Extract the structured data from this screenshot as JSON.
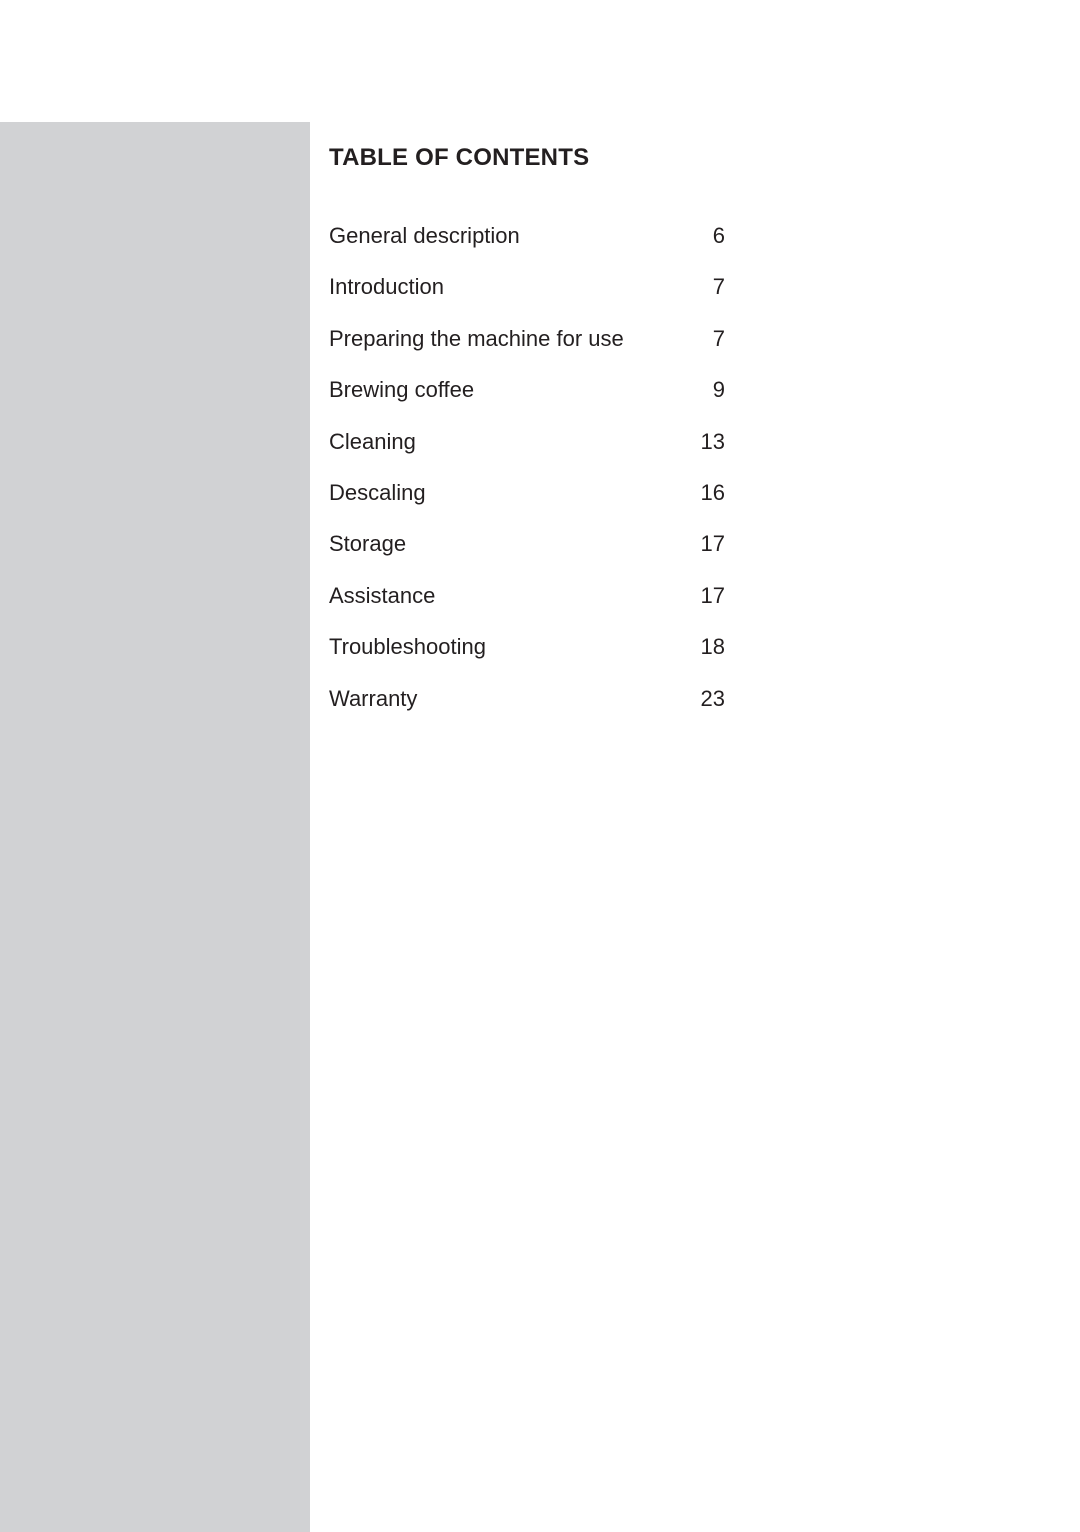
{
  "page": {
    "background_color": "#ffffff",
    "sidebar_color": "#d1d2d4",
    "text_color": "#231f20"
  },
  "toc": {
    "heading": "TABLE OF CONTENTS",
    "entries": [
      {
        "title": "General description",
        "page": "6"
      },
      {
        "title": "Introduction",
        "page": "7"
      },
      {
        "title": "Preparing the machine for use",
        "page": "7"
      },
      {
        "title": "Brewing coffee",
        "page": "9"
      },
      {
        "title": "Cleaning",
        "page": "13"
      },
      {
        "title": "Descaling",
        "page": "16"
      },
      {
        "title": "Storage",
        "page": "17"
      },
      {
        "title": "Assistance",
        "page": "17"
      },
      {
        "title": "Troubleshooting",
        "page": "18"
      },
      {
        "title": "Warranty",
        "page": "23"
      }
    ]
  }
}
